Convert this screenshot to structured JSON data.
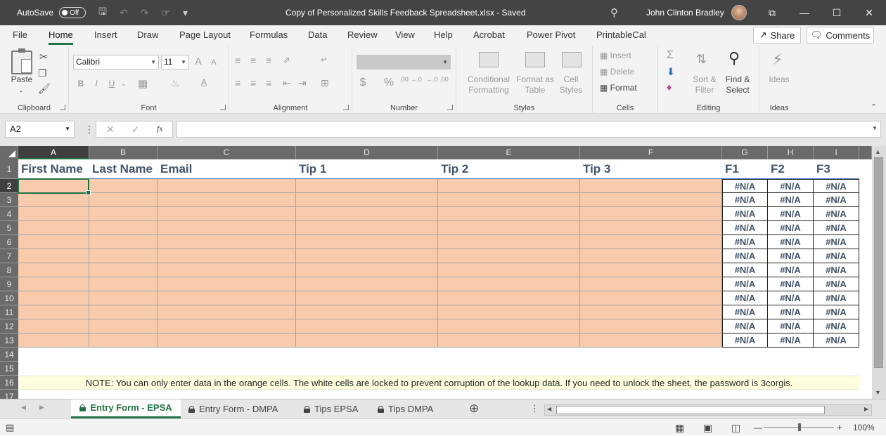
{
  "title_bar": {
    "autosave_label": "AutoSave",
    "autosave_state": "Off",
    "document_title": "Copy of Personalized Skills Feedback Spreadsheet.xlsx  -  Saved",
    "user_name": "John Clinton Bradley"
  },
  "menu": {
    "items": [
      "File",
      "Home",
      "Insert",
      "Draw",
      "Page Layout",
      "Formulas",
      "Data",
      "Review",
      "View",
      "Help",
      "Acrobat",
      "Power Pivot",
      "PrintableCal"
    ],
    "share": "Share",
    "comments": "Comments"
  },
  "ribbon": {
    "clipboard": {
      "paste": "Paste",
      "label": "Clipboard"
    },
    "font": {
      "name": "Calibri",
      "size": "11",
      "label": "Font",
      "bold": "B",
      "italic": "I",
      "underline": "U",
      "grow": "A",
      "shrink": "A",
      "font_color": "A"
    },
    "alignment": {
      "label": "Alignment"
    },
    "number": {
      "label": "Number",
      "currency": "$",
      "percent": "%",
      "inc_dec": ".00 →.0",
      "dec_dec": "←.0 .00"
    },
    "styles": {
      "label": "Styles",
      "conditional": "Conditional",
      "conditional2": "Formatting",
      "format_as": "Format as",
      "format_as2": "Table",
      "cell": "Cell",
      "cell2": "Styles"
    },
    "cells": {
      "label": "Cells",
      "insert": "Insert",
      "delete": "Delete",
      "format": "Format"
    },
    "editing": {
      "label": "Editing",
      "sort": "Sort &",
      "sort2": "Filter",
      "find": "Find &",
      "find2": "Select"
    },
    "ideas": {
      "label": "Ideas",
      "ideas_btn": "Ideas"
    }
  },
  "formula_bar": {
    "name_box": "A2",
    "fx": "fx",
    "formula": ""
  },
  "sheet": {
    "columns": [
      "A",
      "B",
      "C",
      "D",
      "E",
      "F",
      "G",
      "H",
      "I"
    ],
    "rows": [
      "1",
      "2",
      "3",
      "4",
      "5",
      "6",
      "7",
      "8",
      "9",
      "10",
      "11",
      "12",
      "13",
      "14",
      "15",
      "16",
      "17"
    ],
    "headers": [
      "First Name",
      "Last Name",
      "Email",
      "Tip 1",
      "Tip 2",
      "Tip 3",
      "F1",
      "F2",
      "F3"
    ],
    "na_value": "#N/A",
    "note": "NOTE: You can only enter data in the orange cells. The white cells are locked to prevent corruption of the lookup data. If you need to unlock the sheet, the password is 3corgis.",
    "data_rows": 12,
    "colors": {
      "entry": "#f8cbad",
      "header_text": "#44546a",
      "note_bg": "#ffffe0",
      "accent": "#217346"
    }
  },
  "tabs": [
    "Entry Form - EPSA",
    "Entry Form - DMPA",
    "Tips EPSA",
    "Tips DMPA"
  ],
  "active_tab": "Entry Form - EPSA",
  "status": {
    "zoom": "100%"
  }
}
